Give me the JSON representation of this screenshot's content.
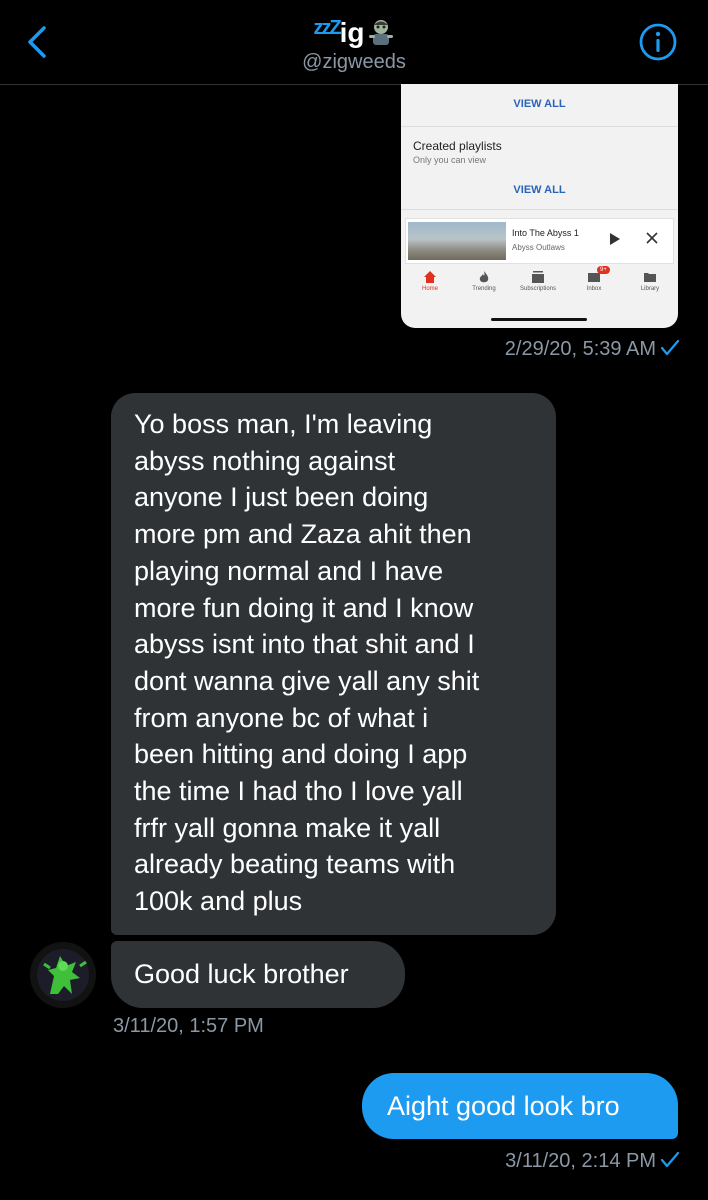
{
  "header": {
    "zzz": "zzZ",
    "name": "ig",
    "handle": "@zigweeds"
  },
  "attachment": {
    "view_all_1": "VIEW ALL",
    "playlists_title": "Created playlists",
    "playlists_sub": "Only you can view",
    "view_all_2": "VIEW ALL",
    "mini_player": {
      "title": "Into The Abyss 1",
      "channel": "Abyss Outlaws"
    },
    "tabs": [
      {
        "label": "Home",
        "icon": "home-icon",
        "active": true
      },
      {
        "label": "Trending",
        "icon": "flame-icon",
        "active": false
      },
      {
        "label": "Subscriptions",
        "icon": "subscriptions-icon",
        "active": false
      },
      {
        "label": "Inbox",
        "icon": "inbox-icon",
        "active": false,
        "badge": "9+"
      },
      {
        "label": "Library",
        "icon": "folder-icon",
        "active": false
      }
    ]
  },
  "messages": {
    "ts_attachment": "2/29/20, 5:39 AM",
    "incoming_1_lines": [
      "Yo boss man, I'm leaving",
      "abyss nothing against",
      "anyone I just been doing",
      "more pm and Zaza ahit then",
      "playing normal and I have",
      "more fun doing it and I know",
      "abyss isnt into that shit and I",
      "dont wanna give yall any shit",
      "from anyone bc of what i",
      "been hitting and doing I app",
      "the time I had tho I love yall",
      "frfr yall gonna make it yall",
      "already beating teams with",
      "100k and plus"
    ],
    "incoming_2": "Good luck brother",
    "ts_incoming": "3/11/20, 1:57 PM",
    "outgoing_1": "Aight good look bro",
    "ts_outgoing": "3/11/20, 2:14 PM"
  },
  "colors": {
    "accent": "#1d9bf0",
    "incoming_bubble": "#2f3336",
    "background": "#000000",
    "secondary_text": "#8b98a5"
  }
}
